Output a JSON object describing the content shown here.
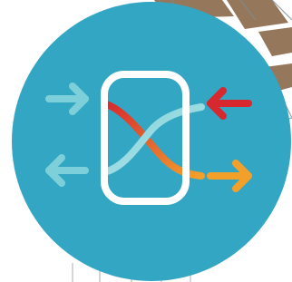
{
  "window": {
    "description_free_background": true
  },
  "icon": {
    "name": "data-exchange-app-icon",
    "circle_color": "#33A6C4",
    "frame_color": "#FFFFFF",
    "arrows": [
      {
        "name": "left-arrow-incoming",
        "direction": "right",
        "color": "#7DD0D9"
      },
      {
        "name": "left-arrow-outgoing",
        "direction": "left",
        "color": "#7DD0D9"
      },
      {
        "name": "right-arrow-incoming",
        "direction": "left",
        "color": "#D7282F"
      },
      {
        "name": "right-arrow-outgoing",
        "direction": "right",
        "color": "#F3A02B"
      }
    ],
    "curves": {
      "cool_color": "#7DD0D9",
      "warm_start": "#D7282F",
      "warm_end": "#F3A02B"
    }
  },
  "background": {
    "wood_color": "#8A6A4B",
    "sketch_color": "#7F8B91",
    "panel_color": "#FFFFFF"
  }
}
